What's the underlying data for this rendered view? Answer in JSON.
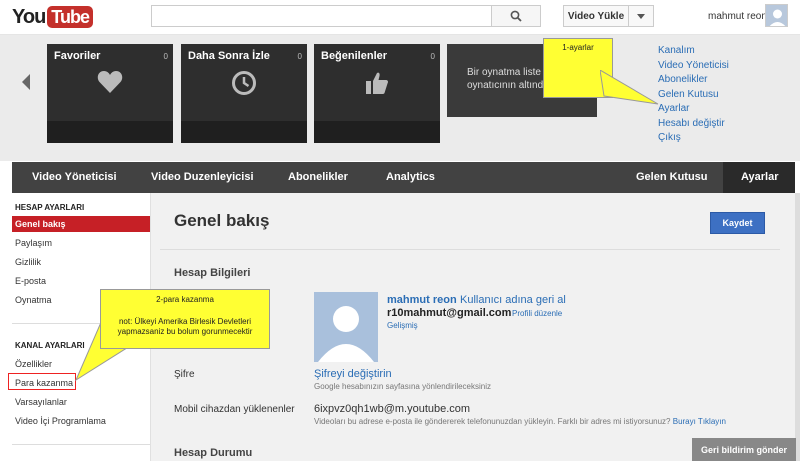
{
  "header": {
    "logo_you": "You",
    "logo_tube": "Tube",
    "search_placeholder": "",
    "upload_label": "Video Yükle",
    "username": "mahmut reon"
  },
  "guide": {
    "cards": [
      {
        "title": "Favoriler",
        "count": "0",
        "icon": "heart-icon"
      },
      {
        "title": "Daha Sonra İzle",
        "count": "0",
        "icon": "clock-icon"
      },
      {
        "title": "Beğenilenler",
        "count": "0",
        "icon": "thumbs-up-icon"
      }
    ],
    "playlist_line1": "Bir oynatma liste",
    "playlist_line2": "oynatıcının altınd",
    "note1": "1-ayarlar",
    "account_links": [
      "Kanalım",
      "Video Yöneticisi",
      "Abonelikler",
      "Gelen Kutusu",
      "Ayarlar",
      "Hesabı değiştir",
      "Çıkış"
    ]
  },
  "nav": {
    "items": [
      "Video Yöneticisi",
      "Video Duzenleyicisi",
      "Abonelikler",
      "Analytics"
    ],
    "inbox": "Gelen Kutusu",
    "settings": "Ayarlar"
  },
  "sidebar": {
    "account_section": "HESAP AYARLARI",
    "account_items": [
      "Genel bakış",
      "Paylaşım",
      "Gizlilik",
      "E-posta",
      "Oynatma"
    ],
    "channel_section": "KANAL AYARLARI",
    "channel_items": [
      "Özellikler",
      "Para kazanma",
      "Varsayılanlar",
      "Video İçi Programlama"
    ],
    "note2_title": "2-para kazanma",
    "note2_body": "not: Ülkeyi Amerika Birlesik Devletleri yapmazsaniz bu bolum gorunmecektir"
  },
  "main": {
    "title": "Genel bakış",
    "save": "Kaydet",
    "account_info": "Hesap Bilgileri",
    "profile_name": "mahmut reon",
    "profile_name_link": "Kullanıcı adına geri al",
    "profile_email": "r10mahmut@gmail.com",
    "profile_edit": "Profili düzenle",
    "advanced": "Gelişmiş",
    "password_label": "Şifre",
    "password_link": "Şifreyi değiştirin",
    "password_hint": "Google hesabınızın sayfasına yönlendirileceksiniz",
    "mobile_label": "Mobil cihazdan yüklenenler",
    "mobile_address": "6ixpvz0qh1wb@m.youtube.com",
    "mobile_hint": "Videoları bu adrese e-posta ile göndererek telefonunuzdan yükleyin. Farklı bir adres mi istiyorsunuz?",
    "mobile_hint_link": "Burayı Tıklayın",
    "account_status": "Hesap Durumu",
    "feedback": "Geri bildirim gönder"
  }
}
